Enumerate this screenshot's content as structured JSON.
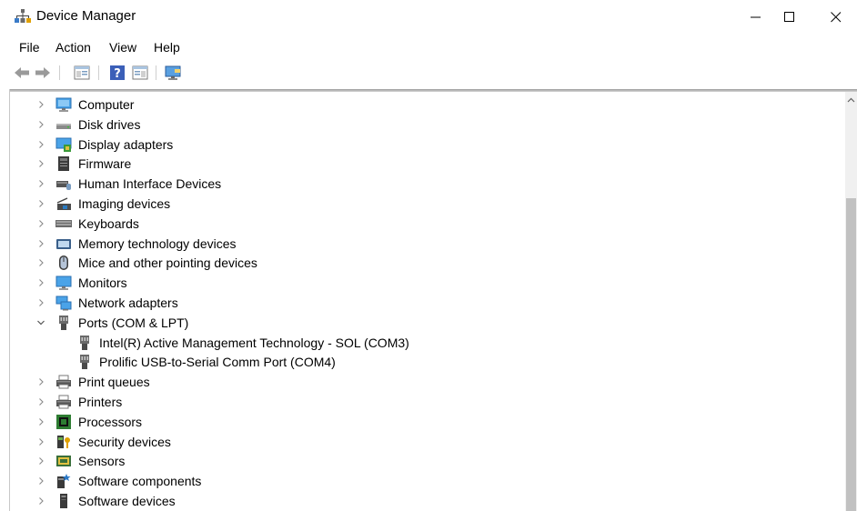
{
  "window": {
    "title": "Device Manager"
  },
  "menu": [
    "File",
    "Action",
    "View",
    "Help"
  ],
  "toolbar": {
    "buttons": [
      "back-icon",
      "forward-icon",
      "properties-pane-icon",
      "help-icon",
      "view-pane-icon",
      "monitor-icon"
    ]
  },
  "tree": {
    "items": [
      {
        "label": "Computer",
        "icon": "computer-icon",
        "expanded": false
      },
      {
        "label": "Disk drives",
        "icon": "disk-drive-icon",
        "expanded": false
      },
      {
        "label": "Display adapters",
        "icon": "display-adapter-icon",
        "expanded": false
      },
      {
        "label": "Firmware",
        "icon": "firmware-icon",
        "expanded": false
      },
      {
        "label": "Human Interface Devices",
        "icon": "hid-icon",
        "expanded": false
      },
      {
        "label": "Imaging devices",
        "icon": "imaging-device-icon",
        "expanded": false
      },
      {
        "label": "Keyboards",
        "icon": "keyboard-icon",
        "expanded": false
      },
      {
        "label": "Memory technology devices",
        "icon": "memory-device-icon",
        "expanded": false
      },
      {
        "label": "Mice and other pointing devices",
        "icon": "mouse-icon",
        "expanded": false
      },
      {
        "label": "Monitors",
        "icon": "monitor-icon",
        "expanded": false
      },
      {
        "label": "Network adapters",
        "icon": "network-adapter-icon",
        "expanded": false
      },
      {
        "label": "Ports (COM & LPT)",
        "icon": "port-icon",
        "expanded": true,
        "children": [
          {
            "label": "Intel(R) Active Management Technology - SOL (COM3)",
            "icon": "port-icon"
          },
          {
            "label": "Prolific USB-to-Serial Comm Port (COM4)",
            "icon": "port-icon"
          }
        ]
      },
      {
        "label": "Print queues",
        "icon": "printer-icon",
        "expanded": false
      },
      {
        "label": "Printers",
        "icon": "printer-icon",
        "expanded": false
      },
      {
        "label": "Processors",
        "icon": "processor-icon",
        "expanded": false
      },
      {
        "label": "Security devices",
        "icon": "security-device-icon",
        "expanded": false
      },
      {
        "label": "Sensors",
        "icon": "sensor-icon",
        "expanded": false
      },
      {
        "label": "Software components",
        "icon": "software-component-icon",
        "expanded": false
      },
      {
        "label": "Software devices",
        "icon": "software-device-icon",
        "expanded": false
      }
    ]
  },
  "colors": {
    "accent_blue": "#2b78c6",
    "chevron": "#8a8a8a",
    "scroll_thumb": "#c1c1c1"
  }
}
